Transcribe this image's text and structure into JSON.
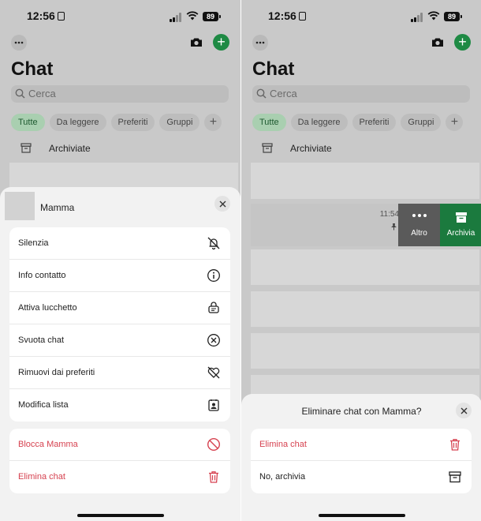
{
  "status": {
    "time": "12:56",
    "battery": "89"
  },
  "header": {
    "title": "Chat"
  },
  "search": {
    "placeholder": "Cerca"
  },
  "chips": [
    "Tutte",
    "Da leggere",
    "Preferiti",
    "Gruppi"
  ],
  "chip_add_label": "+",
  "archived_label": "Archiviate",
  "colors": {
    "accent_green": "#1e8a44",
    "danger_red": "#d64250",
    "altro_gray": "#5a5a5a",
    "archivia_green": "#1b7a3e"
  },
  "left_sheet": {
    "contact_name": "Mamma",
    "menu_items": [
      {
        "label": "Silenzia",
        "icon": "bell-slash-icon"
      },
      {
        "label": "Info contatto",
        "icon": "info-icon"
      },
      {
        "label": "Attiva lucchetto",
        "icon": "chat-lock-icon"
      },
      {
        "label": "Svuota chat",
        "icon": "circle-x-icon"
      },
      {
        "label": "Rimuovi dai preferiti",
        "icon": "heart-slash-icon"
      },
      {
        "label": "Modifica lista",
        "icon": "contact-list-icon"
      }
    ],
    "danger_items": [
      {
        "label": "Blocca Mamma",
        "icon": "block-icon"
      },
      {
        "label": "Elimina chat",
        "icon": "trash-icon"
      }
    ]
  },
  "right_panel": {
    "swipe_row": {
      "time": "11:54"
    },
    "actions": [
      {
        "label": "Altro",
        "icon": "more-dots-icon"
      },
      {
        "label": "Archivia",
        "icon": "archive-box-icon"
      }
    ],
    "sheet": {
      "title": "Eliminare chat con Mamma?",
      "items": [
        {
          "label": "Elimina chat",
          "icon": "trash-icon"
        },
        {
          "label": "No, archivia",
          "icon": "archive-box-icon"
        }
      ]
    }
  }
}
